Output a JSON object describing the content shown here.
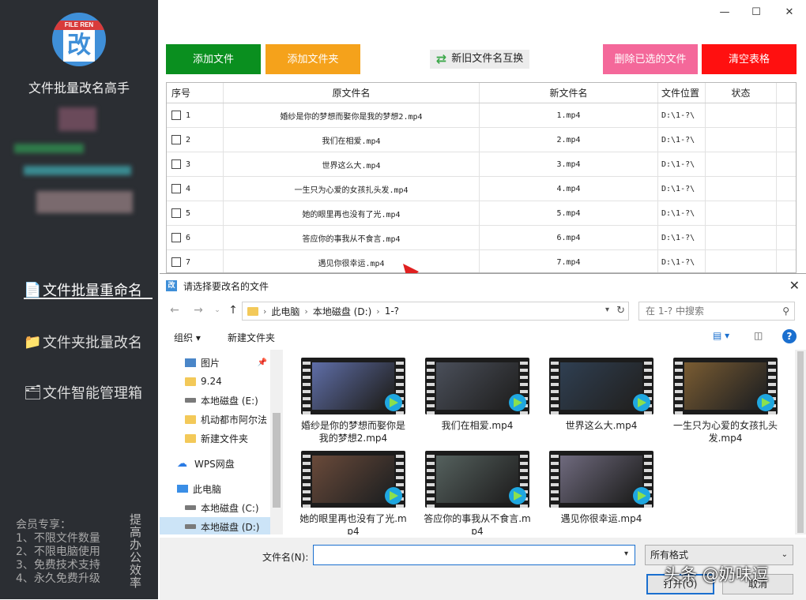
{
  "app": {
    "title": "文件批量改名高手",
    "logo_band": "FILE REN",
    "logo_char": "改"
  },
  "sidebar": {
    "nav": [
      {
        "label": "文件批量重命名",
        "icon": "document-list-icon"
      },
      {
        "label": "文件夹批量改名",
        "icon": "folder-icon"
      },
      {
        "label": "文件智能管理箱",
        "icon": "toolbox-icon"
      }
    ],
    "member_title": "会员专享：",
    "member_items": [
      "1、不限文件数量",
      "2、不限电脑使用",
      "3、免费技术支持",
      "4、永久免费升级"
    ],
    "slogan": "提高办公效率"
  },
  "window": {
    "minimize": "—",
    "maximize": "☐",
    "close": "✕"
  },
  "toolbar": {
    "add_file": "添加文件",
    "add_folder": "添加文件夹",
    "swap": "新旧文件名互换",
    "delete_selected": "删除已选的文件",
    "clear_table": "清空表格",
    "colors": {
      "add_file": "#0a8f1f",
      "add_folder": "#f5a21b",
      "delete_selected": "#f4689a",
      "clear_table": "#ff1010"
    }
  },
  "table": {
    "headers": [
      "序号",
      "原文件名",
      "新文件名",
      "文件位置",
      "状态"
    ],
    "rows": [
      {
        "seq": "1",
        "original": "婚纱是你的梦想而娶你是我的梦想2.mp4",
        "new": "1.mp4",
        "location": "D:\\1-?\\",
        "status": ""
      },
      {
        "seq": "2",
        "original": "我们在相爱.mp4",
        "new": "2.mp4",
        "location": "D:\\1-?\\",
        "status": ""
      },
      {
        "seq": "3",
        "original": "世界这么大.mp4",
        "new": "3.mp4",
        "location": "D:\\1-?\\",
        "status": ""
      },
      {
        "seq": "4",
        "original": "一生只为心爱的女孩扎头发.mp4",
        "new": "4.mp4",
        "location": "D:\\1-?\\",
        "status": ""
      },
      {
        "seq": "5",
        "original": "她的眼里再也没有了光.mp4",
        "new": "5.mp4",
        "location": "D:\\1-?\\",
        "status": ""
      },
      {
        "seq": "6",
        "original": "答应你的事我从不食言.mp4",
        "new": "6.mp4",
        "location": "D:\\1-?\\",
        "status": ""
      },
      {
        "seq": "7",
        "original": "遇见你很幸运.mp4",
        "new": "7.mp4",
        "location": "D:\\1-?\\",
        "status": ""
      }
    ]
  },
  "dialog": {
    "title": "请选择要改名的文件",
    "breadcrumb": [
      "此电脑",
      "本地磁盘 (D:)",
      "1-?"
    ],
    "search_placeholder": "在 1-? 中搜索",
    "organize": "组织 ▾",
    "new_folder": "新建文件夹",
    "nav_items": [
      {
        "label": "图片",
        "icon": "pictures-icon",
        "pinned": true
      },
      {
        "label": "9.24",
        "icon": "folder-icon"
      },
      {
        "label": "本地磁盘 (E:)",
        "icon": "drive-icon"
      },
      {
        "label": "机动都市阿尔法",
        "icon": "folder-icon"
      },
      {
        "label": "新建文件夹",
        "icon": "folder-icon"
      },
      {
        "label": "WPS网盘",
        "icon": "cloud-icon"
      },
      {
        "label": "此电脑",
        "icon": "pc-icon"
      },
      {
        "label": "本地磁盘 (C:)",
        "icon": "drive-icon"
      },
      {
        "label": "本地磁盘 (D:)",
        "icon": "drive-icon",
        "selected": true
      }
    ],
    "files": [
      {
        "name": "婚纱是你的梦想而娶你是我的梦想2.mp4",
        "tone": "#5f6ea8"
      },
      {
        "name": "我们在相爱.mp4",
        "tone": "#4a4f5a"
      },
      {
        "name": "世界这么大.mp4",
        "tone": "#2f3f52"
      },
      {
        "name": "一生只为心爱的女孩扎头发.mp4",
        "tone": "#7a5c32"
      },
      {
        "name": "她的眼里再也没有了光.mp4",
        "tone": "#6a4a3a"
      },
      {
        "name": "答应你的事我从不食言.mp4",
        "tone": "#55615e"
      },
      {
        "name": "遇见你很幸运.mp4",
        "tone": "#6f6a7e"
      }
    ],
    "filename_label": "文件名(N):",
    "filename_value": "",
    "file_type": "所有格式",
    "open_button": "打开(O)",
    "cancel_button": "取消"
  },
  "watermark": "头条 @奶味逗"
}
